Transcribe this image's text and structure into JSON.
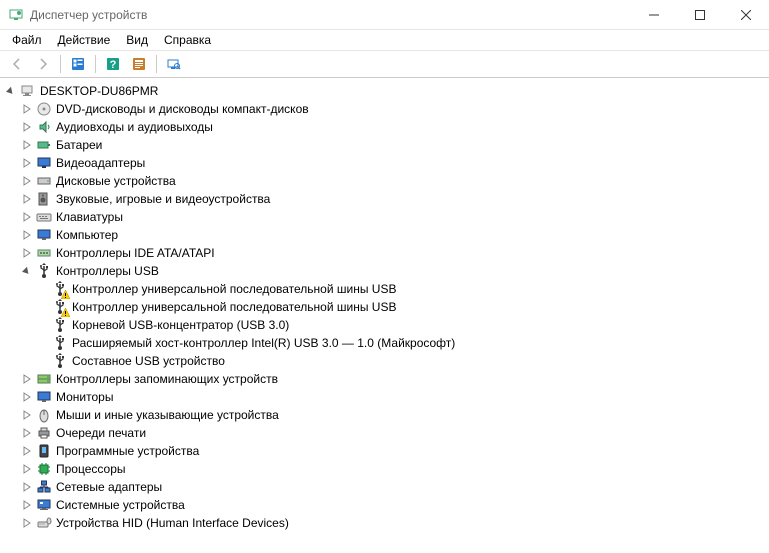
{
  "window": {
    "title": "Диспетчер устройств"
  },
  "menu": {
    "file": "Файл",
    "action": "Действие",
    "view": "Вид",
    "help": "Справка"
  },
  "tree": {
    "root": {
      "label": "DESKTOP-DU86PMR",
      "expanded": true
    },
    "categories": [
      {
        "id": "dvd",
        "label": "DVD-дисководы и дисководы компакт-дисков",
        "icon": "disc",
        "expanded": false
      },
      {
        "id": "audio",
        "label": "Аудиовходы и аудиовыходы",
        "icon": "audio",
        "expanded": false
      },
      {
        "id": "battery",
        "label": "Батареи",
        "icon": "battery",
        "expanded": false
      },
      {
        "id": "video",
        "label": "Видеоадаптеры",
        "icon": "display",
        "expanded": false
      },
      {
        "id": "disk",
        "label": "Дисковые устройства",
        "icon": "hdd",
        "expanded": false
      },
      {
        "id": "sound",
        "label": "Звуковые, игровые и видеоустройства",
        "icon": "speaker",
        "expanded": false
      },
      {
        "id": "keyboard",
        "label": "Клавиатуры",
        "icon": "keyboard",
        "expanded": false
      },
      {
        "id": "computer",
        "label": "Компьютер",
        "icon": "monitor",
        "expanded": false
      },
      {
        "id": "ide",
        "label": "Контроллеры IDE ATA/ATAPI",
        "icon": "ide",
        "expanded": false
      },
      {
        "id": "usb",
        "label": "Контроллеры USB",
        "icon": "usb",
        "expanded": true,
        "children": [
          {
            "label": "Контроллер универсальной последовательной шины USB",
            "icon": "usb",
            "warning": true
          },
          {
            "label": "Контроллер универсальной последовательной шины USB",
            "icon": "usb",
            "warning": true
          },
          {
            "label": "Корневой USB-концентратор (USB 3.0)",
            "icon": "usb",
            "warning": false
          },
          {
            "label": "Расширяемый хост-контроллер Intel(R) USB 3.0 — 1.0 (Майкрософт)",
            "icon": "usb",
            "warning": false
          },
          {
            "label": "Составное USB устройство",
            "icon": "usb",
            "warning": false
          }
        ]
      },
      {
        "id": "storage",
        "label": "Контроллеры запоминающих устройств",
        "icon": "storage",
        "expanded": false
      },
      {
        "id": "monitors",
        "label": "Мониторы",
        "icon": "monitor",
        "expanded": false
      },
      {
        "id": "mouse",
        "label": "Мыши и иные указывающие устройства",
        "icon": "mouse",
        "expanded": false
      },
      {
        "id": "printq",
        "label": "Очереди печати",
        "icon": "printer",
        "expanded": false
      },
      {
        "id": "software",
        "label": "Программные устройства",
        "icon": "software",
        "expanded": false
      },
      {
        "id": "cpu",
        "label": "Процессоры",
        "icon": "cpu",
        "expanded": false
      },
      {
        "id": "network",
        "label": "Сетевые адаптеры",
        "icon": "network",
        "expanded": false
      },
      {
        "id": "system",
        "label": "Системные устройства",
        "icon": "system",
        "expanded": false
      },
      {
        "id": "hid",
        "label": "Устройства HID (Human Interface Devices)",
        "icon": "hid",
        "expanded": false
      }
    ]
  }
}
